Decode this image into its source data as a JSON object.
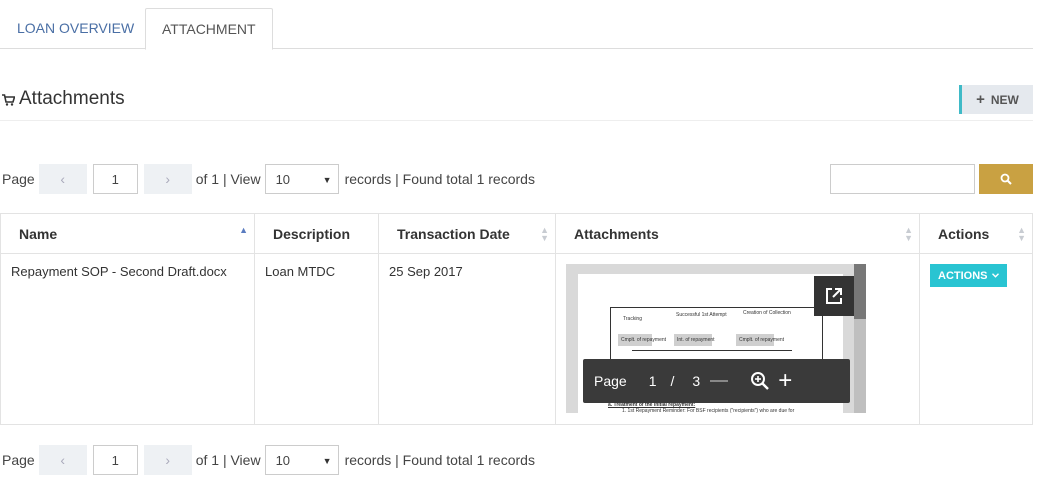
{
  "tabs": [
    {
      "label": "LOAN OVERVIEW"
    },
    {
      "label": "ATTACHMENT"
    }
  ],
  "section": {
    "title": "Attachments",
    "new_label": "NEW"
  },
  "pager": {
    "page_label": "Page",
    "prev": "‹",
    "next": "›",
    "page_value": "1",
    "of_text": "of 1 | View",
    "view_value": "10",
    "records_text": "records | Found total 1 records"
  },
  "table": {
    "headers": [
      "Name",
      "Description",
      "Transaction Date",
      "Attachments",
      "Actions"
    ],
    "rows": [
      {
        "name": "Repayment SOP - Second Draft.docx",
        "description": "Loan MTDC",
        "date": "25 Sep 2017",
        "action_label": "ACTIONS"
      }
    ]
  },
  "viewer": {
    "page_label": "Page",
    "current": "1",
    "sep": "/",
    "total": "3"
  },
  "doc": {
    "cells": [
      "Tracking",
      "Successful 1st Attempt",
      "Creation of Collection",
      "Cmplt. of repayment",
      "Int. of repayment",
      "Cmplt. of repayment"
    ],
    "heading": "a. Treatment of the initial repayment:",
    "line": "1. 1st Repayment Reminder: For BSF recipients (\"recipients\") who are due for"
  },
  "colors": {
    "accent": "#3fbac7",
    "search_button": "#c9a142",
    "actions_button": "#29c4d2",
    "tab_link": "#4a6fa5"
  },
  "icons": {
    "title": "shopping-cart-icon",
    "new": "plus-icon",
    "search": "search-icon",
    "popout": "open-external-icon",
    "zoom": "zoom-in-icon"
  }
}
